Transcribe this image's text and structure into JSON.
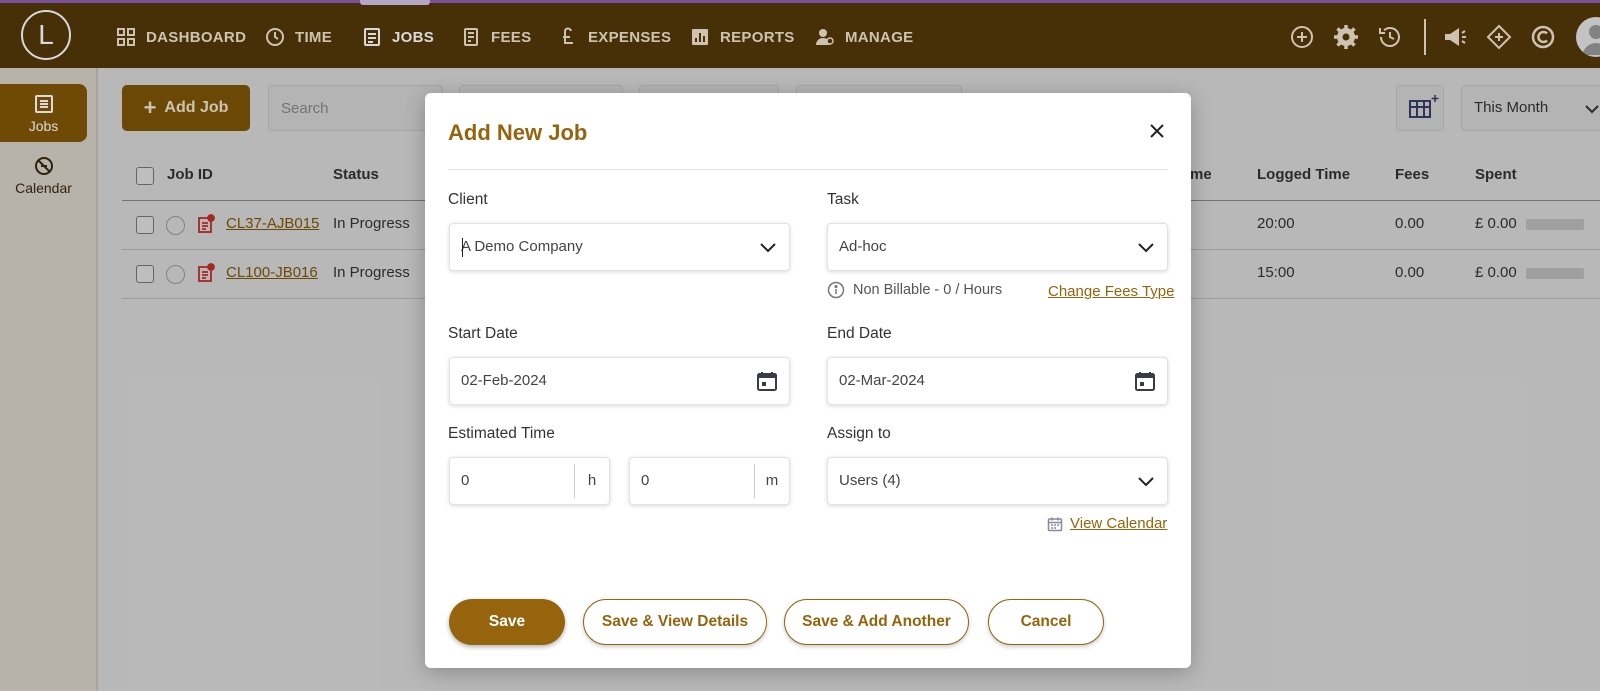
{
  "app": {
    "logo_letter": "L",
    "nav": [
      {
        "label": "DASHBOARD",
        "icon": "dashboard-icon"
      },
      {
        "label": "TIME",
        "icon": "clock-icon"
      },
      {
        "label": "JOBS",
        "icon": "jobs-icon"
      },
      {
        "label": "FEES",
        "icon": "fees-icon"
      },
      {
        "label": "EXPENSES",
        "icon": "pound-icon"
      },
      {
        "label": "REPORTS",
        "icon": "reports-icon"
      },
      {
        "label": "MANAGE",
        "icon": "manage-icon"
      }
    ],
    "active_nav": "JOBS",
    "top_icons": [
      "add-circle-icon",
      "gear-icon",
      "history-icon",
      "megaphone-icon",
      "diamond-icon",
      "copyright-icon"
    ]
  },
  "sidebar": {
    "items": [
      {
        "label": "Jobs",
        "icon": "list-icon",
        "active": true
      },
      {
        "label": "Calendar",
        "icon": "calendar-off-icon",
        "active": false
      }
    ]
  },
  "toolbar": {
    "add_job_label": "Add Job",
    "search_placeholder": "Search",
    "period_label": "This Month"
  },
  "table": {
    "headers": {
      "job_id": "Job ID",
      "status": "Status",
      "time_partial": "me",
      "logged_time": "Logged Time",
      "fees": "Fees",
      "spent": "Spent"
    },
    "rows": [
      {
        "job_id": "CL37-AJB015",
        "status": "In Progress",
        "logged_time": "20:00",
        "fees": "0.00",
        "spent": "£ 0.00"
      },
      {
        "job_id": "CL100-JB016",
        "status": "In Progress",
        "logged_time": "15:00",
        "fees": "0.00",
        "spent": "£ 0.00"
      }
    ]
  },
  "modal": {
    "title": "Add New Job",
    "client": {
      "label": "Client",
      "value": "A Demo Company"
    },
    "task": {
      "label": "Task",
      "value": "Ad-hoc"
    },
    "billing_info": "Non Billable - 0 / Hours",
    "change_fees_link": "Change Fees Type",
    "start_date": {
      "label": "Start Date",
      "value": "02-Feb-2024"
    },
    "end_date": {
      "label": "End Date",
      "value": "02-Mar-2024"
    },
    "estimated_time": {
      "label": "Estimated Time",
      "hours": "0",
      "hours_unit": "h",
      "minutes": "0",
      "minutes_unit": "m"
    },
    "assign_to": {
      "label": "Assign to",
      "value": "Users (4)"
    },
    "view_calendar_link": "View Calendar",
    "buttons": {
      "save": "Save",
      "save_view": "Save & View Details",
      "save_add": "Save & Add Another",
      "cancel": "Cancel"
    }
  },
  "colors": {
    "header_bg": "#54380a",
    "accent": "#96640d",
    "accent_dark": "#7f5509",
    "top_accent": "#8e5fb8",
    "link_row": "#7f5509"
  }
}
